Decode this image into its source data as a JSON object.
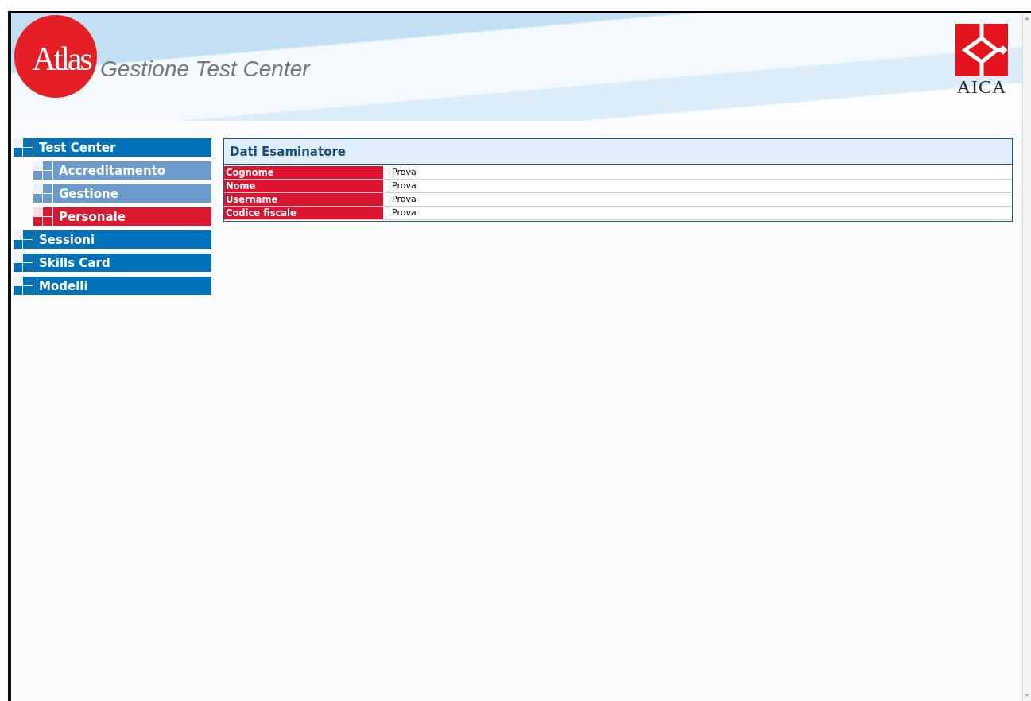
{
  "header": {
    "logo_text": "Atlas",
    "title": "Gestione Test Center",
    "partner_logo_text": "AICA"
  },
  "nav": {
    "items": [
      {
        "label": "Test Center",
        "selected": false,
        "children": [
          {
            "label": "Accreditamento",
            "selected": false
          },
          {
            "label": "Gestione",
            "selected": false
          },
          {
            "label": "Personale",
            "selected": true
          }
        ]
      },
      {
        "label": "Sessioni",
        "selected": false
      },
      {
        "label": "Skills Card",
        "selected": false
      },
      {
        "label": "Modelli",
        "selected": false
      }
    ]
  },
  "panel": {
    "title": "Dati Esaminatore",
    "fields": [
      {
        "label": "Cognome",
        "value": "Prova"
      },
      {
        "label": "Nome",
        "value": "Prova"
      },
      {
        "label": "Username",
        "value": "Prova"
      },
      {
        "label": "Codice fiscale",
        "value": "Prova"
      }
    ]
  }
}
